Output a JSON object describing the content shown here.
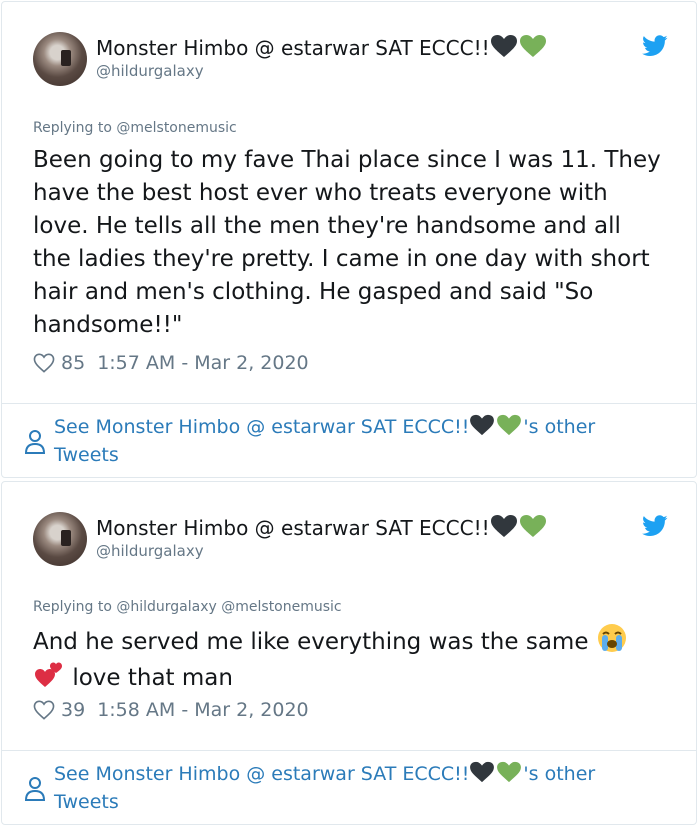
{
  "tweets": [
    {
      "author_name": "Monster Himbo @ estarwar SAT ECCC!!",
      "handle": "@hildurgalaxy",
      "replying_to": "Replying to @melstonemusic",
      "text": "Been going to my fave Thai place since I was 11. They have the best host ever who treats everyone with love. He tells all the men they're handsome and all the ladies they're pretty. I came in one day with short hair and men's clothing. He gasped and said \"So handsome!!\"",
      "likes": "85",
      "timestamp": "1:57 AM - Mar 2, 2020",
      "other_tweets_prefix": "See Monster Himbo @ estarwar SAT ECCC!!",
      "other_tweets_suffix": "'s other Tweets"
    },
    {
      "author_name": "Monster Himbo @ estarwar SAT ECCC!!",
      "handle": "@hildurgalaxy",
      "replying_to": "Replying to @hildurgalaxy @melstonemusic",
      "text_part1": "And he served me like everything was the same",
      "text_part2": "love that man",
      "likes": "39",
      "timestamp": "1:58 AM - Mar 2, 2020",
      "other_tweets_prefix": "See Monster Himbo @ estarwar SAT ECCC!!",
      "other_tweets_suffix": "'s other Tweets"
    }
  ],
  "colors": {
    "text": "#14171a",
    "muted": "#657786",
    "link": "#2b7bb9",
    "twitter_blue": "#1da1f2",
    "border": "#e1e8ed",
    "heart_green": "#78b159",
    "heart_black": "#31373d",
    "heart_red": "#dd2e44"
  }
}
